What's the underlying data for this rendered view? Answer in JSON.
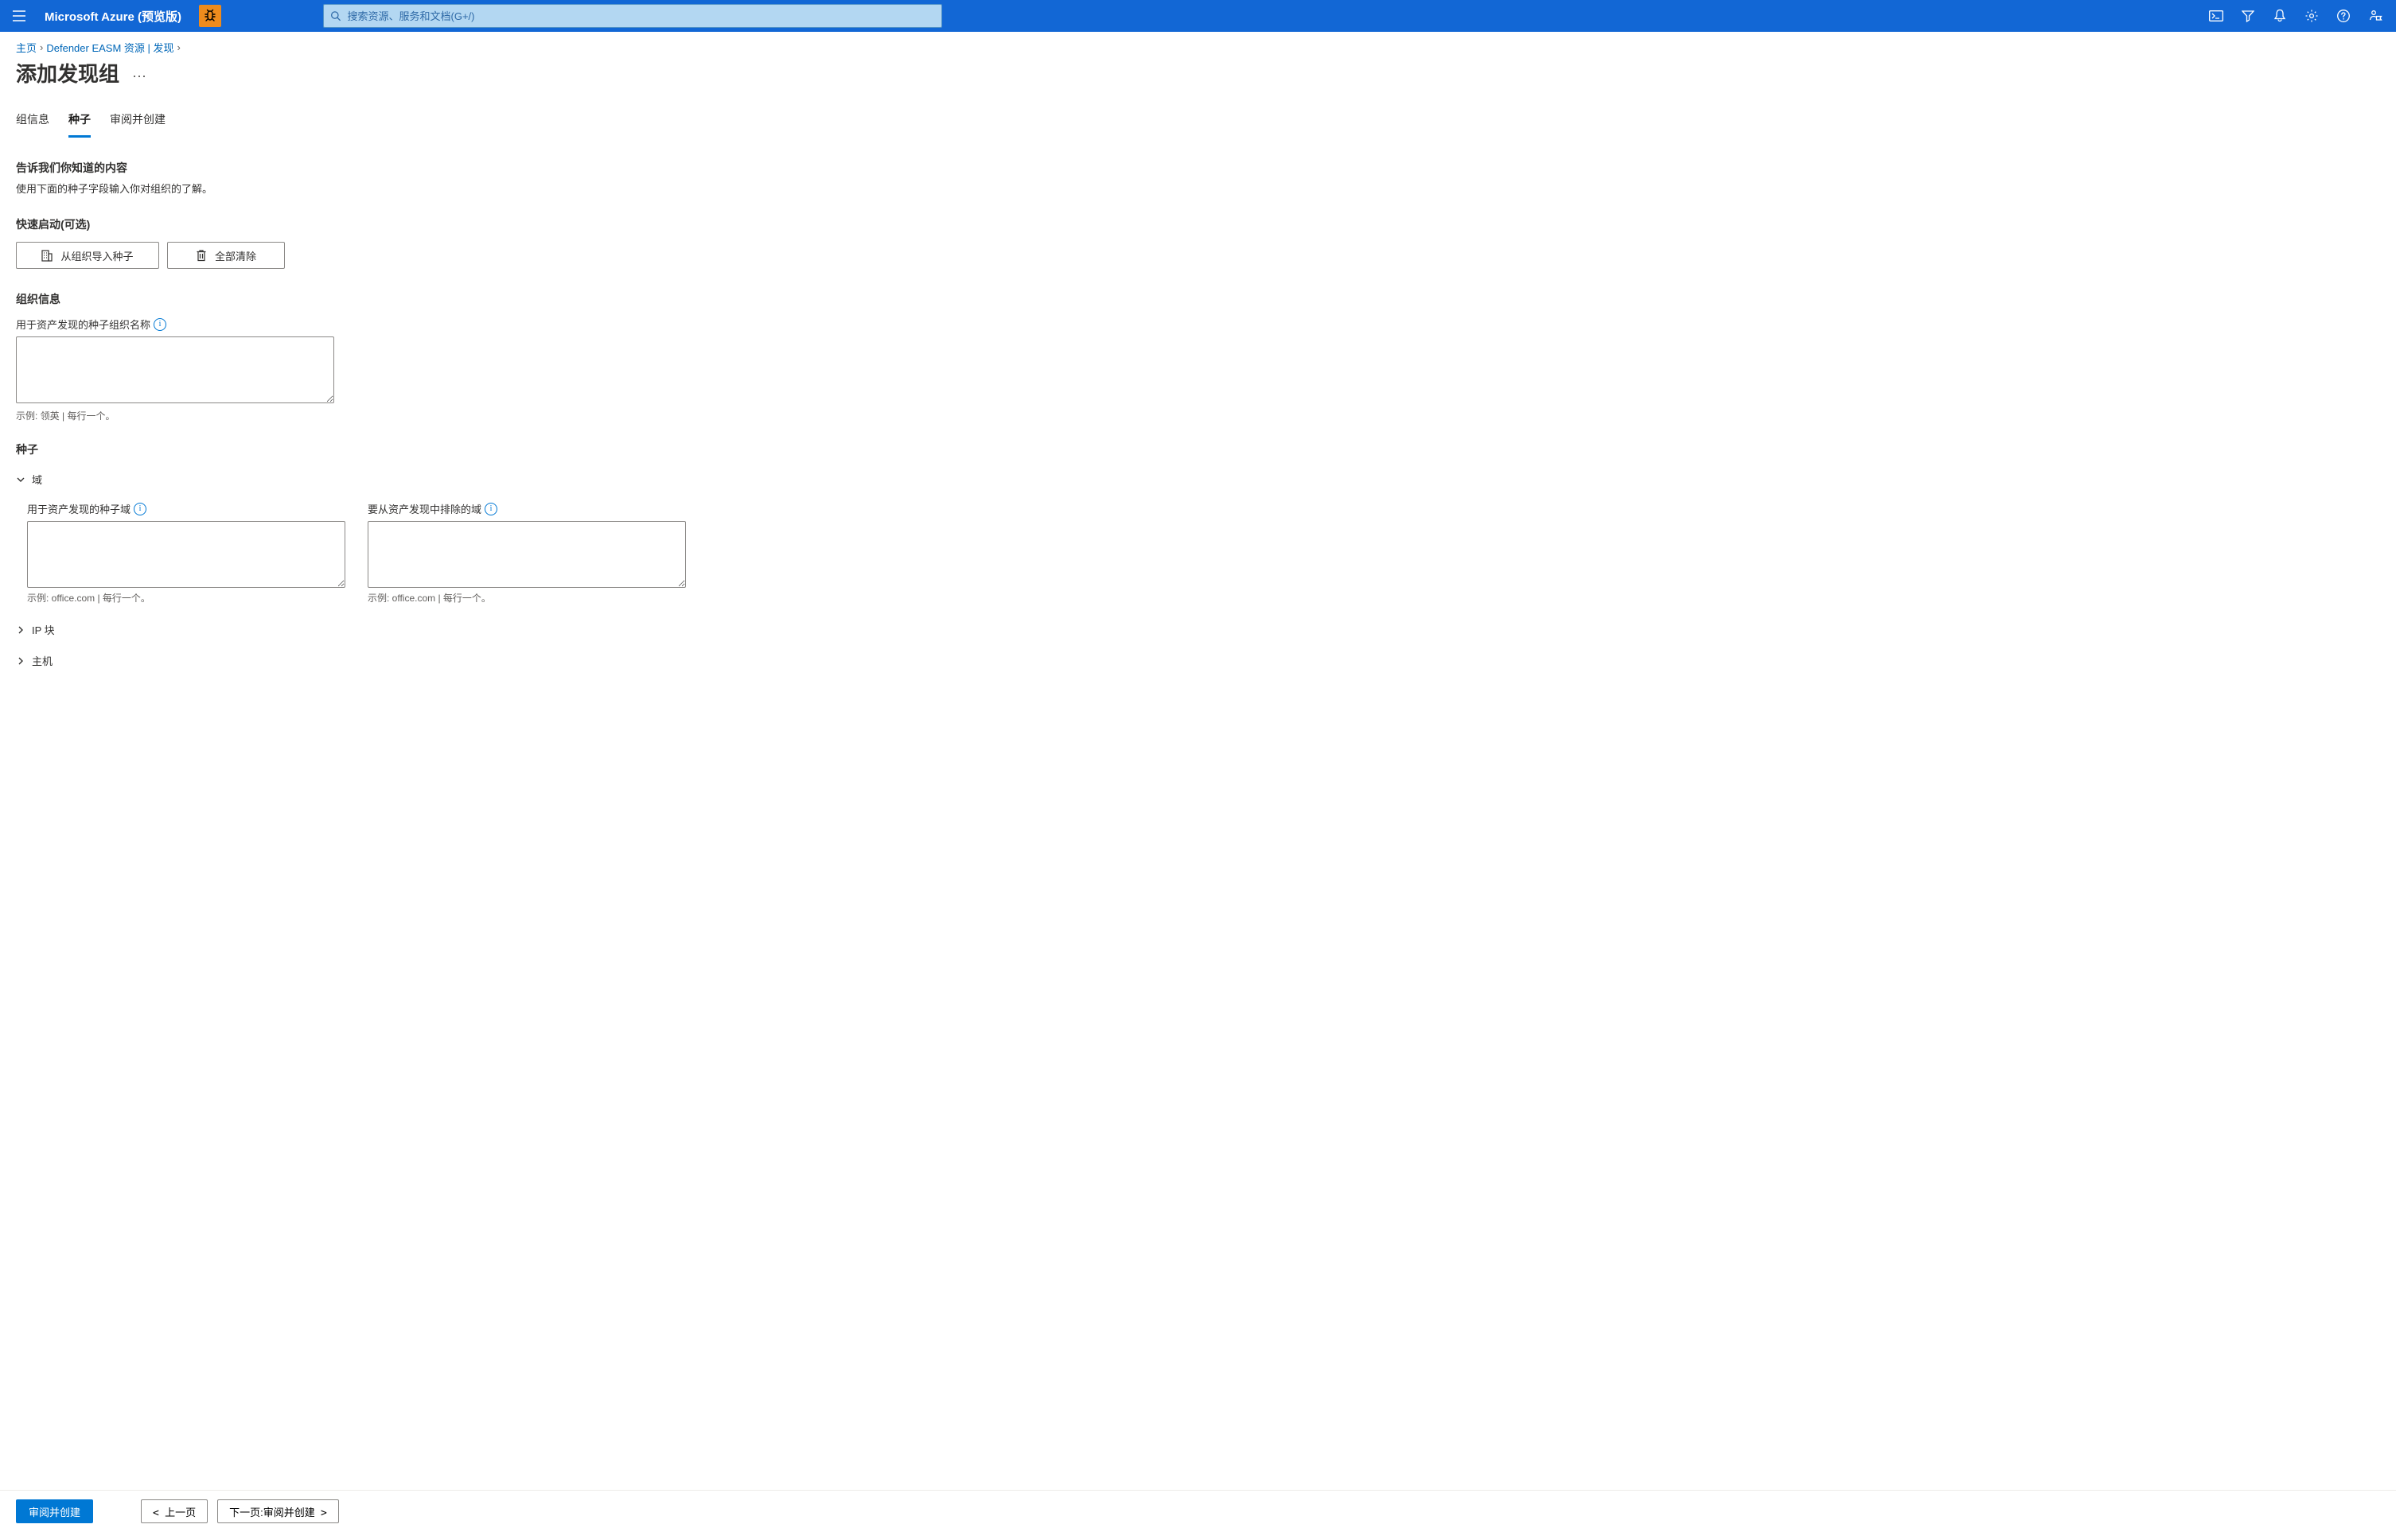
{
  "header": {
    "brand": "Microsoft Azure (预览版)",
    "search_placeholder": "搜索资源、服务和文档(G+/)"
  },
  "breadcrumb": {
    "home": "主页",
    "resource": "Defender EASM 资源 | 发现"
  },
  "page": {
    "title": "添加发现组"
  },
  "tabs": {
    "group_info": "组信息",
    "seeds": "种子",
    "review_create": "审阅并创建"
  },
  "intro": {
    "heading": "告诉我们你知道的内容",
    "sub": "使用下面的种子字段输入你对组织的了解。"
  },
  "quickstart": {
    "heading": "快速启动(可选)",
    "import_btn": "从组织导入种子",
    "clear_btn": "全部清除"
  },
  "org_info": {
    "heading": "组织信息",
    "label": "用于资产发现的种子组织名称",
    "hint": "示例:  领英 | 每行一个。"
  },
  "seeds": {
    "heading": "种子",
    "domains": {
      "title": "域",
      "include_label": "用于资产发现的种子域",
      "exclude_label": "要从资产发现中排除的域",
      "hint_include": "示例: office.com | 每行一个。",
      "hint_exclude": "示例: office.com | 每行一个。"
    },
    "ip_blocks": {
      "title": "IP 块"
    },
    "hosts": {
      "title": "主机"
    }
  },
  "footer": {
    "review_create": "审阅并创建",
    "prev": "上一页",
    "next": "下一页:审阅并创建"
  }
}
